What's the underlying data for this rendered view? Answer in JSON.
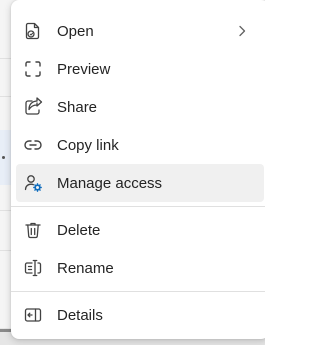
{
  "menu": {
    "items": [
      {
        "label": "Open",
        "icon": "open-file-icon",
        "has_submenu": true
      },
      {
        "label": "Preview",
        "icon": "preview-icon"
      },
      {
        "label": "Share",
        "icon": "share-icon"
      },
      {
        "label": "Copy link",
        "icon": "link-icon"
      },
      {
        "label": "Manage access",
        "icon": "manage-access-icon",
        "highlighted": true
      },
      {
        "label": "Delete",
        "icon": "trash-icon"
      },
      {
        "label": "Rename",
        "icon": "rename-icon"
      },
      {
        "label": "Details",
        "icon": "details-icon"
      }
    ]
  },
  "colors": {
    "accent": "#0f6cbd",
    "text": "#242424",
    "highlight": "#f0f0f0"
  }
}
